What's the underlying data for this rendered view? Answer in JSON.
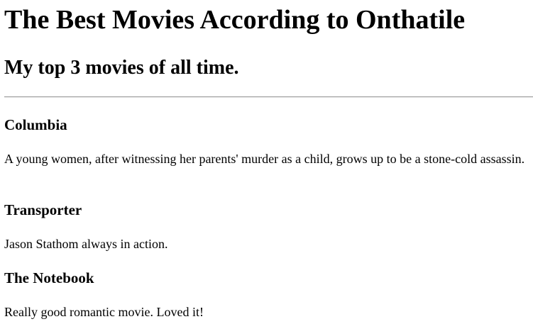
{
  "page": {
    "title": "The Best Movies According to Onthatile",
    "subtitle": "My top 3 movies of all time."
  },
  "movies": [
    {
      "title": "Columbia",
      "description": "A young women, after witnessing her parents' murder as a child, grows up to be a stone-cold assassin."
    },
    {
      "title": "Transporter",
      "description": "Jason Stathom always in action."
    },
    {
      "title": "The Notebook",
      "description": "Really good romantic movie. Loved it!"
    }
  ]
}
